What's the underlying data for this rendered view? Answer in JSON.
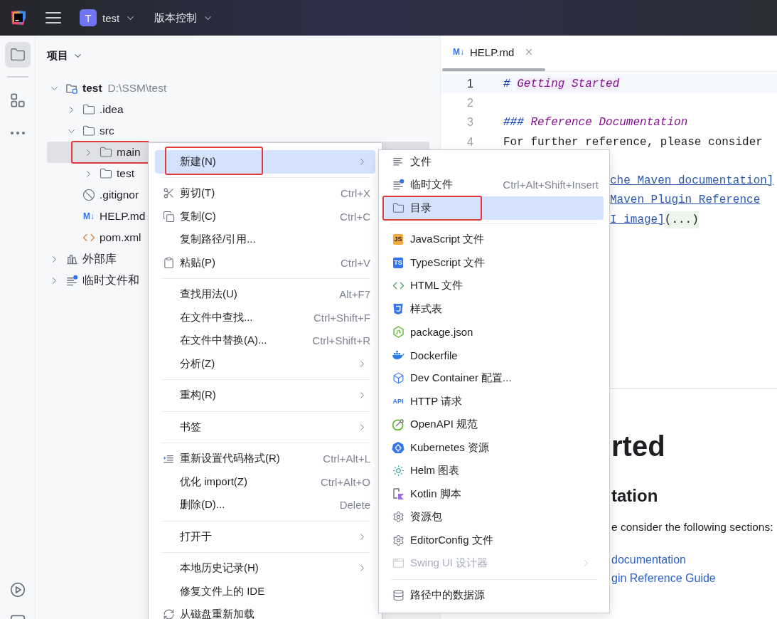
{
  "topbar": {
    "project": {
      "badge": "T",
      "name": "test"
    },
    "vcs": "版本控制"
  },
  "tool_buttons": [
    {
      "selected": true
    },
    {
      "selected": false
    },
    {
      "selected": false
    }
  ],
  "bottom_tool_buttons": [
    {
      "selected": false
    },
    {
      "selected": false
    }
  ],
  "project_panel": {
    "title": "项目",
    "tree": [
      {
        "label": "test",
        "path": "D:\\SSM\\test",
        "kind": "module",
        "expanded": true,
        "selected": false,
        "children": [
          {
            "label": ".idea",
            "kind": "folder",
            "expanded": false,
            "selected": false
          },
          {
            "label": "src",
            "kind": "folder",
            "expanded": true,
            "selected": false,
            "children": [
              {
                "label": "main",
                "kind": "folder",
                "expanded": false,
                "selected": true,
                "outlined": true
              },
              {
                "label": "test",
                "kind": "folder",
                "expanded": false,
                "selected": false
              }
            ]
          },
          {
            "label": ".gitignor",
            "kind": "ignore-file",
            "selected": false
          },
          {
            "label": "HELP.md",
            "kind": "markdown-file",
            "badge": "M↓",
            "selected": false
          },
          {
            "label": "pom.xml",
            "kind": "xml-file",
            "selected": false
          }
        ]
      },
      {
        "label": "外部库",
        "kind": "library",
        "expanded": false,
        "selected": false
      },
      {
        "label": "临时文件和",
        "kind": "scratches",
        "expanded": false,
        "selected": false
      }
    ]
  },
  "editor": {
    "tab": {
      "badge": "M↓",
      "name": "HELP.md",
      "selected": true
    },
    "lines": [
      {
        "number": "1",
        "current": true,
        "parts": [
          {
            "kind": "marker",
            "text": "# "
          },
          {
            "kind": "heading",
            "text": "Getting Started"
          }
        ]
      },
      {
        "number": "2",
        "current": false
      },
      {
        "number": "3",
        "current": false,
        "parts": [
          {
            "kind": "marker",
            "text": "### "
          },
          {
            "kind": "heading-plain",
            "text": "Reference Documentation"
          }
        ]
      },
      {
        "number": "4",
        "current": false,
        "parts": [
          {
            "kind": "plain",
            "text": "For further reference, please consider"
          }
        ]
      }
    ],
    "continued_lines": [
      {
        "parts": [
          {
            "kind": "link",
            "text": "che Maven documentation]"
          }
        ]
      },
      {
        "parts": [
          {
            "kind": "link",
            "text": "Maven Plugin Reference"
          }
        ]
      },
      {
        "parts": [
          {
            "kind": "link",
            "text": "I image]"
          },
          {
            "kind": "fold",
            "text": "(...)"
          }
        ]
      }
    ],
    "preview": [
      {
        "kind": "h1",
        "text": "rted"
      },
      {
        "kind": "h2",
        "text": "tation"
      },
      {
        "kind": "p",
        "text": "e consider the following sections:"
      },
      {
        "kind": "link",
        "text": "documentation"
      },
      {
        "kind": "link",
        "text": "gin Reference Guide"
      }
    ]
  },
  "context_menu": {
    "groups": [
      {
        "items": [
          {
            "label": "新建(N)",
            "submenu": true,
            "selected": true,
            "outlined": true
          }
        ]
      },
      {
        "items": [
          {
            "label": "剪切(T)",
            "shortcut": "Ctrl+X",
            "submenu": false,
            "selected": false
          },
          {
            "label": "复制(C)",
            "shortcut": "Ctrl+C",
            "submenu": false,
            "selected": false
          },
          {
            "label": "复制路径/引用...",
            "submenu": false,
            "selected": false
          },
          {
            "label": "粘贴(P)",
            "shortcut": "Ctrl+V",
            "submenu": false,
            "selected": false
          }
        ]
      },
      {
        "items": [
          {
            "label": "查找用法(U)",
            "shortcut": "Alt+F7",
            "submenu": false,
            "selected": false
          },
          {
            "label": "在文件中查找...",
            "shortcut": "Ctrl+Shift+F",
            "submenu": false,
            "selected": false
          },
          {
            "label": "在文件中替换(A)...",
            "shortcut": "Ctrl+Shift+R",
            "submenu": false,
            "selected": false
          },
          {
            "label": "分析(Z)",
            "submenu": true,
            "selected": false
          }
        ]
      },
      {
        "items": [
          {
            "label": "重构(R)",
            "submenu": true,
            "selected": false
          }
        ]
      },
      {
        "items": [
          {
            "label": "书签",
            "submenu": true,
            "selected": false
          }
        ]
      },
      {
        "items": [
          {
            "label": "重新设置代码格式(R)",
            "shortcut": "Ctrl+Alt+L",
            "submenu": false,
            "selected": false
          },
          {
            "label": "优化 import(Z)",
            "shortcut": "Ctrl+Alt+O",
            "submenu": false,
            "selected": false
          },
          {
            "label": "删除(D)...",
            "shortcut": "Delete",
            "submenu": false,
            "selected": false
          }
        ]
      },
      {
        "items": [
          {
            "label": "打开于",
            "submenu": true,
            "selected": false
          }
        ]
      },
      {
        "items": [
          {
            "label": "本地历史记录(H)",
            "submenu": true,
            "selected": false
          },
          {
            "label": "修复文件上的 IDE",
            "submenu": false,
            "selected": false
          },
          {
            "label": "从磁盘重新加载",
            "submenu": false,
            "selected": false
          }
        ]
      }
    ]
  },
  "submenu": {
    "groups": [
      {
        "items": [
          {
            "label": "文件",
            "submenu": false,
            "selected": false,
            "disabled": false
          },
          {
            "label": "临时文件",
            "shortcut": "Ctrl+Alt+Shift+Insert",
            "submenu": false,
            "selected": false,
            "disabled": false
          },
          {
            "label": "目录",
            "submenu": false,
            "selected": true,
            "disabled": false,
            "outlined": true
          }
        ]
      },
      {
        "items": [
          {
            "label": "JavaScript 文件",
            "badge": "JS",
            "submenu": false,
            "selected": false,
            "disabled": false
          },
          {
            "label": "TypeScript 文件",
            "badge": "TS",
            "submenu": false,
            "selected": false,
            "disabled": false
          },
          {
            "label": "HTML 文件",
            "submenu": false,
            "selected": false,
            "disabled": false
          },
          {
            "label": "样式表",
            "submenu": false,
            "selected": false,
            "disabled": false
          },
          {
            "label": "package.json",
            "submenu": false,
            "selected": false,
            "disabled": false
          },
          {
            "label": "Dockerfile",
            "submenu": false,
            "selected": false,
            "disabled": false
          },
          {
            "label": "Dev Container 配置...",
            "submenu": false,
            "selected": false,
            "disabled": false
          },
          {
            "label": "HTTP 请求",
            "badge": "API",
            "submenu": false,
            "selected": false,
            "disabled": false
          },
          {
            "label": "OpenAPI 规范",
            "submenu": false,
            "selected": false,
            "disabled": false
          },
          {
            "label": "Kubernetes 资源",
            "submenu": false,
            "selected": false,
            "disabled": false
          },
          {
            "label": "Helm 图表",
            "submenu": false,
            "selected": false,
            "disabled": false
          },
          {
            "label": "Kotlin 脚本",
            "submenu": false,
            "selected": false,
            "disabled": false
          },
          {
            "label": "资源包",
            "submenu": false,
            "selected": false,
            "disabled": false
          },
          {
            "label": "EditorConfig 文件",
            "submenu": false,
            "selected": false,
            "disabled": false
          },
          {
            "label": "Swing UI 设计器",
            "submenu": true,
            "selected": false,
            "disabled": true
          }
        ]
      },
      {
        "items": [
          {
            "label": "路径中的数据源",
            "submenu": false,
            "selected": false,
            "disabled": false
          }
        ]
      }
    ]
  }
}
